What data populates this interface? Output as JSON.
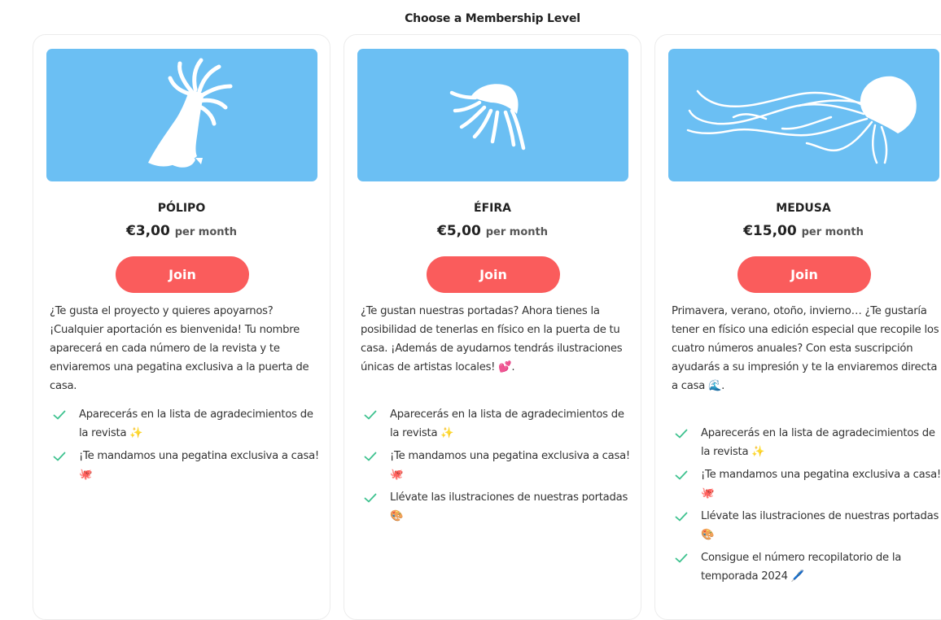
{
  "heading": "Choose a Membership Level",
  "colors": {
    "accent": "#fa5c5c",
    "art_bg": "#6bbff3",
    "check": "#3ec28f"
  },
  "cards": [
    {
      "name": "PÓLIPO",
      "price": "€3,00",
      "period": "per month",
      "join_label": "Join",
      "description": "¿Te gusta el proyecto y quieres apoyarnos? ¡Cualquier aportación es bienvenida! Tu nombre aparecerá en cada número de la revista y te enviaremos una pegatina exclusiva a la puerta de casa.",
      "benefits": [
        "Aparecerás en la lista de agradecimientos de la revista ✨",
        "¡Te mandamos una pegatina exclusiva a casa! 🐙"
      ]
    },
    {
      "name": "ÉFIRA",
      "price": "€5,00",
      "period": "per month",
      "join_label": "Join",
      "description": "¿Te gustan nuestras portadas? Ahora tienes la posibilidad de tenerlas en físico en la puerta de tu casa. ¡Además de ayudarnos tendrás ilustraciones únicas de artistas locales! 💕.",
      "benefits": [
        "Aparecerás en la lista de agradecimientos de la revista ✨",
        "¡Te mandamos una pegatina exclusiva a casa! 🐙",
        "Llévate las ilustraciones de nuestras portadas 🎨"
      ]
    },
    {
      "name": "MEDUSA",
      "price": "€15,00",
      "period": "per month",
      "join_label": "Join",
      "description": "Primavera, verano, otoño, invierno… ¿Te gustaría tener en físico una edición especial que recopile los cuatro números anuales? Con esta suscripción ayudarás a su impresión y te la enviaremos directa a casa 🌊.",
      "benefits": [
        "Aparecerás en la lista de agradecimientos de la revista ✨",
        "¡Te mandamos una pegatina exclusiva a casa! 🐙",
        "Llévate las ilustraciones de nuestras portadas 🎨",
        "Consigue el número recopilatorio de la temporada 2024 🖊️"
      ]
    }
  ]
}
